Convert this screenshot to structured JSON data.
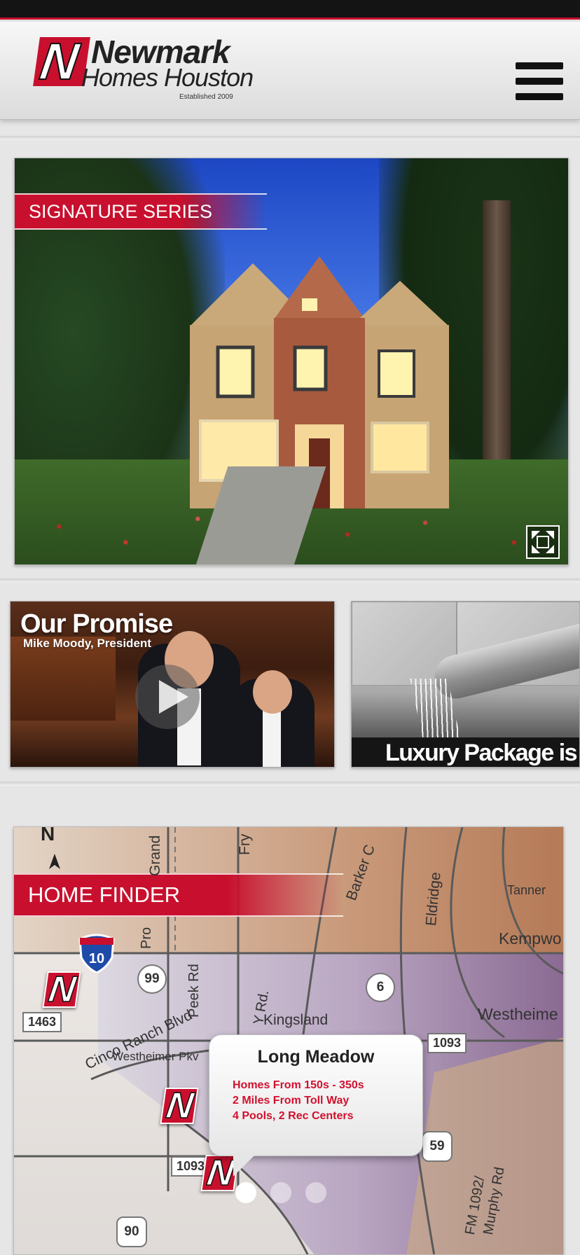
{
  "header": {
    "logo_mark": "N",
    "logo_line1": "Newmark",
    "logo_line2": "Homes Houston",
    "logo_established": "Established 2009",
    "menu_icon": "hamburger-menu-icon"
  },
  "hero": {
    "ribbon_label": "SIGNATURE SERIES",
    "expand_icon": "expand-fullscreen-icon"
  },
  "thumbnails": {
    "video": {
      "title": "Our Promise",
      "subtitle": "Mike Moody, President",
      "play_icon": "play-icon"
    },
    "luxury": {
      "caption": "Luxury Package is"
    }
  },
  "map": {
    "ribbon_label": "HOME FINDER",
    "north": "N",
    "roads": {
      "grand": "Grand",
      "fry": "Fry",
      "barker_cypress": "Barker C",
      "eldridge": "Eldridge",
      "tanner": "Tanner",
      "kempwood": "Kempwo",
      "westheimer": "Westheime",
      "kingsland": "Kingsland",
      "peek_rd": "Peek Rd",
      "fry_rd": "Y Rd.",
      "cinco_ranch": "Cinco Ranch Blvd",
      "westheimer_pkwy": "Westheimer Pkv",
      "prov": "Pro",
      "fm1092": "FM 1092/",
      "murphy": "Murphy Rd"
    },
    "shields": {
      "i10": "10",
      "hw99": "99",
      "hw6": "6",
      "fm1463": "1463",
      "fm1093a": "1093",
      "fm1093b": "1093",
      "hw59": "59",
      "hw90": "90"
    },
    "callout": {
      "title": "Long Meadow",
      "lines": [
        "Homes From 150s - 350s",
        "2 Miles From Toll Way",
        "4 Pools, 2 Rec Centers"
      ]
    },
    "marker_letter": "N"
  },
  "pager": {
    "count": 3,
    "active_index": 0
  },
  "colors": {
    "brand_red": "#c8102e",
    "header_bg": "#eeeeee",
    "status_bar": "#141414"
  }
}
